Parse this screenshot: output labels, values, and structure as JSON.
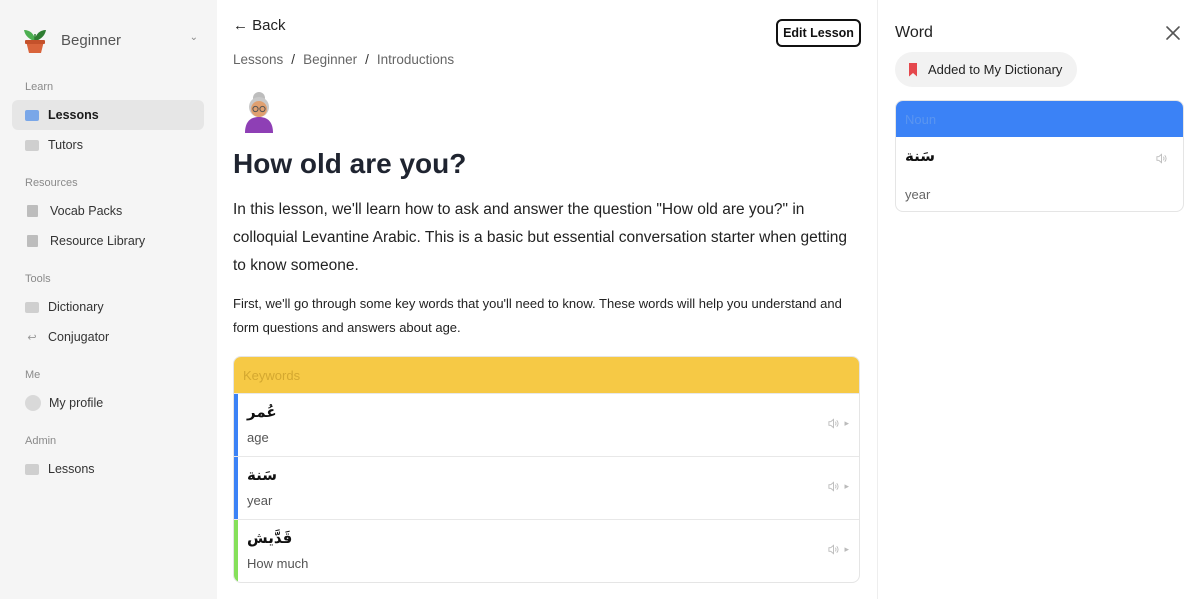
{
  "sidebar": {
    "level_selector": "Beginner",
    "sections": [
      {
        "title": "Learn",
        "items": [
          {
            "label": "Lessons",
            "icon": "newspaper-icon",
            "active": true
          },
          {
            "label": "Tutors",
            "icon": "newspaper-icon"
          }
        ]
      },
      {
        "title": "Resources",
        "items": [
          {
            "label": "Vocab Packs",
            "icon": "book-icon"
          },
          {
            "label": "Resource Library",
            "icon": "book-icon"
          }
        ]
      },
      {
        "title": "Tools",
        "items": [
          {
            "label": "Dictionary",
            "icon": "newspaper-icon"
          },
          {
            "label": "Conjugator",
            "icon": "arrow-back-icon"
          }
        ]
      },
      {
        "title": "Me",
        "items": [
          {
            "label": "My profile",
            "icon": "avatar-icon"
          }
        ]
      },
      {
        "title": "Admin",
        "items": [
          {
            "label": "Lessons",
            "icon": "newspaper-icon"
          }
        ]
      }
    ]
  },
  "main": {
    "back_label": "Back",
    "edit_label": "Edit Lesson",
    "breadcrumb": [
      "Lessons",
      "Beginner",
      "Introductions"
    ],
    "title": "How old are you?",
    "intro": "In this lesson, we'll learn how to ask and answer the question \"How old are you?\" in colloquial Levantine Arabic. This is a basic but essential conversation starter when getting to know someone.",
    "intro2": "First, we'll go through some key words that you'll need to know. These words will help you understand and form questions and answers about age.",
    "keywords_title": "Keywords",
    "keywords": [
      {
        "arabic": "عُمر",
        "english": "age",
        "bar_color": "#3b82f6"
      },
      {
        "arabic": "سَنة",
        "english": "year",
        "bar_color": "#3b82f6"
      },
      {
        "arabic": "قَدَّيش",
        "english": "How much",
        "bar_color": "#86e05a"
      }
    ]
  },
  "panel": {
    "title": "Word",
    "added_label": "Added to My Dictionary",
    "part_of_speech": "Noun",
    "arabic": "سَنة",
    "english": "year"
  },
  "colors": {
    "accent_yellow": "#f6c945",
    "accent_blue": "#3b82f6",
    "bookmark_red": "#e5484d"
  }
}
